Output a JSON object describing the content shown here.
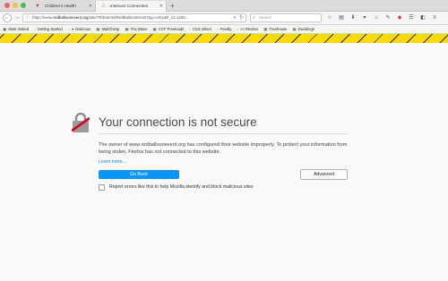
{
  "tabs": [
    {
      "label": "Children's Health",
      "icon": "heart-icon",
      "active": false
    },
    {
      "label": "Insecure Connection",
      "icon": "warning-icon",
      "active": true
    }
  ],
  "address_bar": {
    "prefix": "https://www.",
    "host": "redballoonevent.org",
    "rest": "/site/TR/Events/RedBalloonEvent?pg=entry&fr_id=1180..."
  },
  "search": {
    "placeholder": "Search"
  },
  "toolbar_icons": [
    "star-icon",
    "bookmarks-icon",
    "download-icon",
    "pocket-icon",
    "home-icon",
    "ext-icon",
    "red-icon",
    "sync-icon",
    "library-icon",
    "menu-icon"
  ],
  "bookmarks": [
    {
      "label": "Most Visited",
      "icon": "folder-icon"
    },
    {
      "label": "Getting Started",
      "icon": "page-icon"
    },
    {
      "label": "✦ Delicious",
      "icon": "page-icon"
    },
    {
      "label": "MailChimp",
      "icon": "folder-icon"
    },
    {
      "label": "The Blaze",
      "icon": "folder-icon"
    },
    {
      "label": "CCF Freeloads",
      "icon": "folder-icon"
    },
    {
      "label": "CSS Inliner",
      "icon": "page-icon"
    },
    {
      "label": "Feedly",
      "icon": "page-icon"
    },
    {
      "label": "<< Resizer",
      "icon": "page-icon"
    },
    {
      "label": "Treehouse",
      "icon": "folder-icon"
    },
    {
      "label": "Ducklings",
      "icon": "folder-icon"
    }
  ],
  "error": {
    "title": "Your connection is not secure",
    "description": "The owner of www.redballoonevent.org has configured their website improperly. To protect your information from being stolen, Firefox has not connected to this website.",
    "learn_more": "Learn more…",
    "go_back": "Go Back",
    "advanced": "Advanced",
    "report_label": "Report errors like this to help Mozilla identify and block malicious sites"
  },
  "colors": {
    "stripe": "#ffd900",
    "primary_button": "#0996f8",
    "link": "#0a84ff"
  }
}
